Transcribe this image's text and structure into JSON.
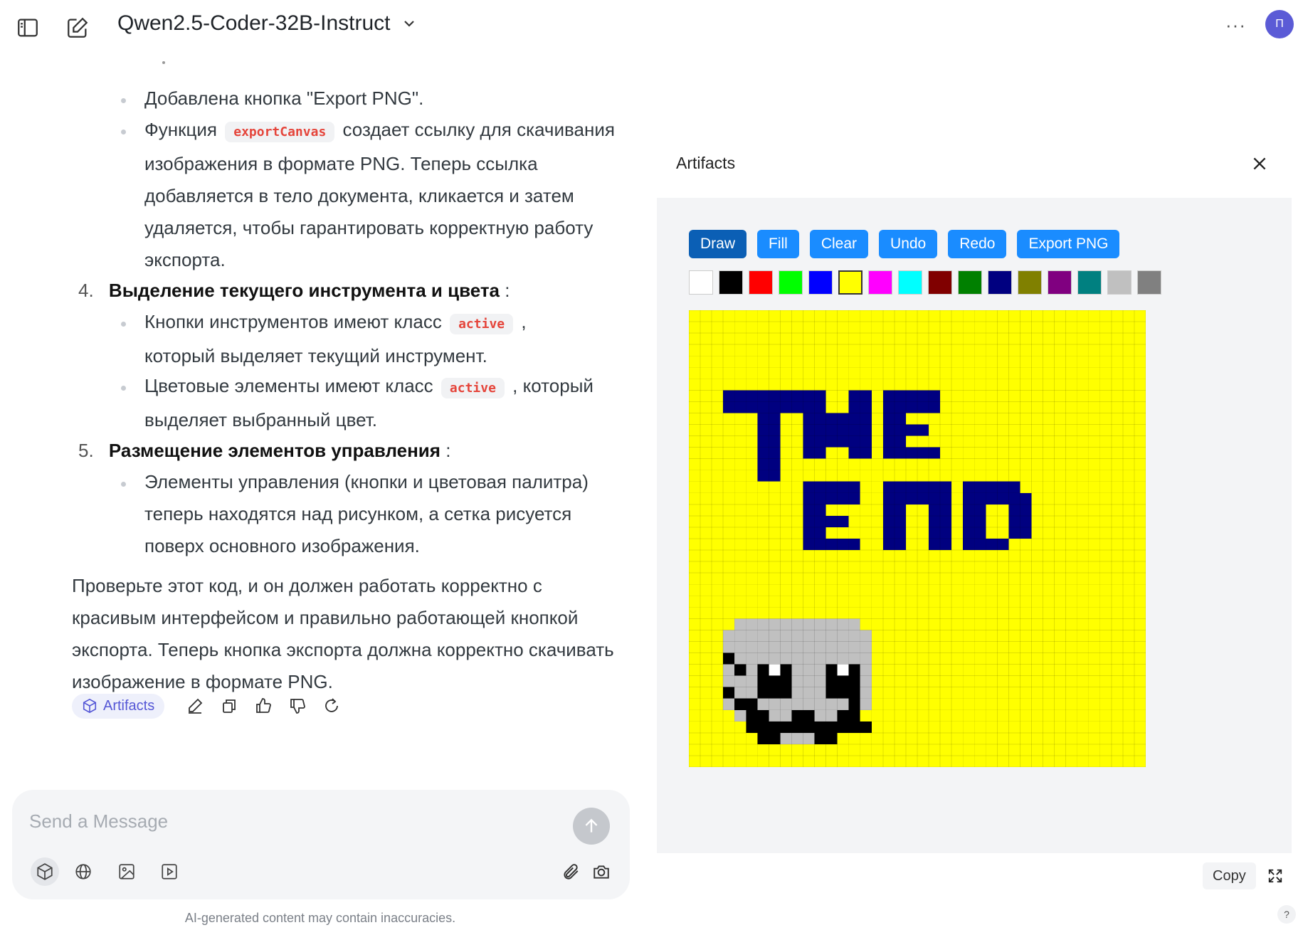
{
  "header": {
    "model_name": "Qwen2.5-Coder-32B-Instruct",
    "avatar_letter": "П"
  },
  "message": {
    "items_top": [
      {
        "text": "Добавлена кнопка \"Export PNG\"."
      },
      {
        "text_before": "Функция",
        "code": "exportCanvas",
        "text_after": "создает ссылку для скачивания изображения в формате PNG. Теперь ссылка добавляется в тело документа, кликается и затем удаляется, чтобы гарантировать корректную работу экспорта."
      }
    ],
    "section4": {
      "number": "4.",
      "title": "Выделение текущего инструмента и цвета",
      "suffix": ":",
      "bullets": [
        {
          "text_before": "Кнопки инструментов имеют класс",
          "code": "active",
          "text_after": ", который выделяет текущий инструмент."
        },
        {
          "text_before": "Цветовые элементы имеют класс",
          "code": "active",
          "text_after": ", который выделяет выбранный цвет."
        }
      ]
    },
    "section5": {
      "number": "5.",
      "title": "Размещение элементов управления",
      "suffix": ":",
      "bullets": [
        {
          "text": "Элементы управления (кнопки и цветовая палитра) теперь находятся над рисунком, а сетка рисуется поверх основного изображения."
        }
      ]
    },
    "closing": "Проверьте этот код, и он должен работать корректно с красивым интерфейсом и правильно работающей кнопкой экспорта. Теперь кнопка экспорта должна корректно скачивать изображение в формате PNG.",
    "artifacts_chip": "Artifacts"
  },
  "composer": {
    "placeholder": "Send a Message",
    "disclaimer": "AI-generated content may contain inaccuracies."
  },
  "artifacts": {
    "title": "Artifacts",
    "tools": [
      "Draw",
      "Fill",
      "Clear",
      "Undo",
      "Redo",
      "Export PNG"
    ],
    "active_tool": "Draw",
    "palette": [
      "#ffffff",
      "#000000",
      "#ff0000",
      "#00ff00",
      "#0000ff",
      "#ffff00",
      "#ff00ff",
      "#00ffff",
      "#800000",
      "#008000",
      "#000080",
      "#808000",
      "#800080",
      "#008080",
      "#c0c0c0",
      "#808080"
    ],
    "selected_color": "#ffff00",
    "copy_label": "Copy",
    "drawing": {
      "background": "#ffff00",
      "text_color": "#000080",
      "face_color": "#c0c0c0",
      "features_color": "#000000",
      "highlight_color": "#ffffff",
      "grid_cells": 40,
      "pixels": {
        "navy": [
          [
            3,
            7,
            8,
            2
          ],
          [
            6,
            9,
            2,
            6
          ],
          [
            10,
            7,
            2,
            6
          ],
          [
            12,
            9,
            2,
            1
          ],
          [
            12,
            10,
            2,
            2
          ],
          [
            14,
            7,
            2,
            6
          ],
          [
            17,
            7,
            5,
            2
          ],
          [
            17,
            9,
            2,
            4
          ],
          [
            19,
            10,
            2,
            1
          ],
          [
            19,
            12,
            3,
            1
          ],
          [
            10,
            15,
            5,
            2
          ],
          [
            10,
            17,
            2,
            4
          ],
          [
            12,
            18,
            2,
            1
          ],
          [
            12,
            20,
            3,
            1
          ],
          [
            17,
            15,
            2,
            6
          ],
          [
            19,
            15,
            4,
            2
          ],
          [
            21,
            17,
            2,
            4
          ],
          [
            24,
            15,
            5,
            2
          ],
          [
            24,
            17,
            2,
            4
          ],
          [
            26,
            20,
            2,
            1
          ],
          [
            28,
            16,
            2,
            4
          ]
        ],
        "face_rows": [
          [
            7,
            5,
            9
          ],
          [
            7,
            4,
            11
          ],
          [
            8,
            3,
            13
          ],
          [
            9,
            3,
            13
          ],
          [
            10,
            3,
            13
          ],
          [
            11,
            3,
            13
          ],
          [
            12,
            3,
            13
          ],
          [
            13,
            3,
            13
          ],
          [
            14,
            3,
            13
          ],
          [
            15,
            4,
            11
          ],
          [
            16,
            5,
            9
          ],
          [
            17,
            6,
            7
          ]
        ],
        "black": [
          [
            10,
            3,
            1
          ],
          [
            11,
            4,
            1
          ],
          [
            13,
            3,
            1
          ],
          [
            14,
            4,
            1
          ],
          [
            11,
            6,
            3
          ],
          [
            12,
            6,
            3
          ],
          [
            13,
            6,
            3
          ],
          [
            11,
            12,
            3
          ],
          [
            12,
            12,
            3
          ],
          [
            13,
            12,
            3
          ],
          [
            14,
            5,
            1
          ],
          [
            14,
            14,
            1
          ],
          [
            15,
            5,
            1
          ],
          [
            15,
            14,
            1
          ],
          [
            16,
            5,
            4
          ],
          [
            16,
            10,
            6
          ],
          [
            17,
            6,
            2
          ],
          [
            17,
            11,
            2
          ],
          [
            15,
            9,
            2
          ],
          [
            15,
            13,
            1
          ],
          [
            15,
            6,
            1
          ],
          [
            16,
            9,
            1
          ]
        ],
        "white": [
          [
            11,
            7,
            1
          ],
          [
            11,
            13,
            1
          ]
        ]
      }
    }
  }
}
